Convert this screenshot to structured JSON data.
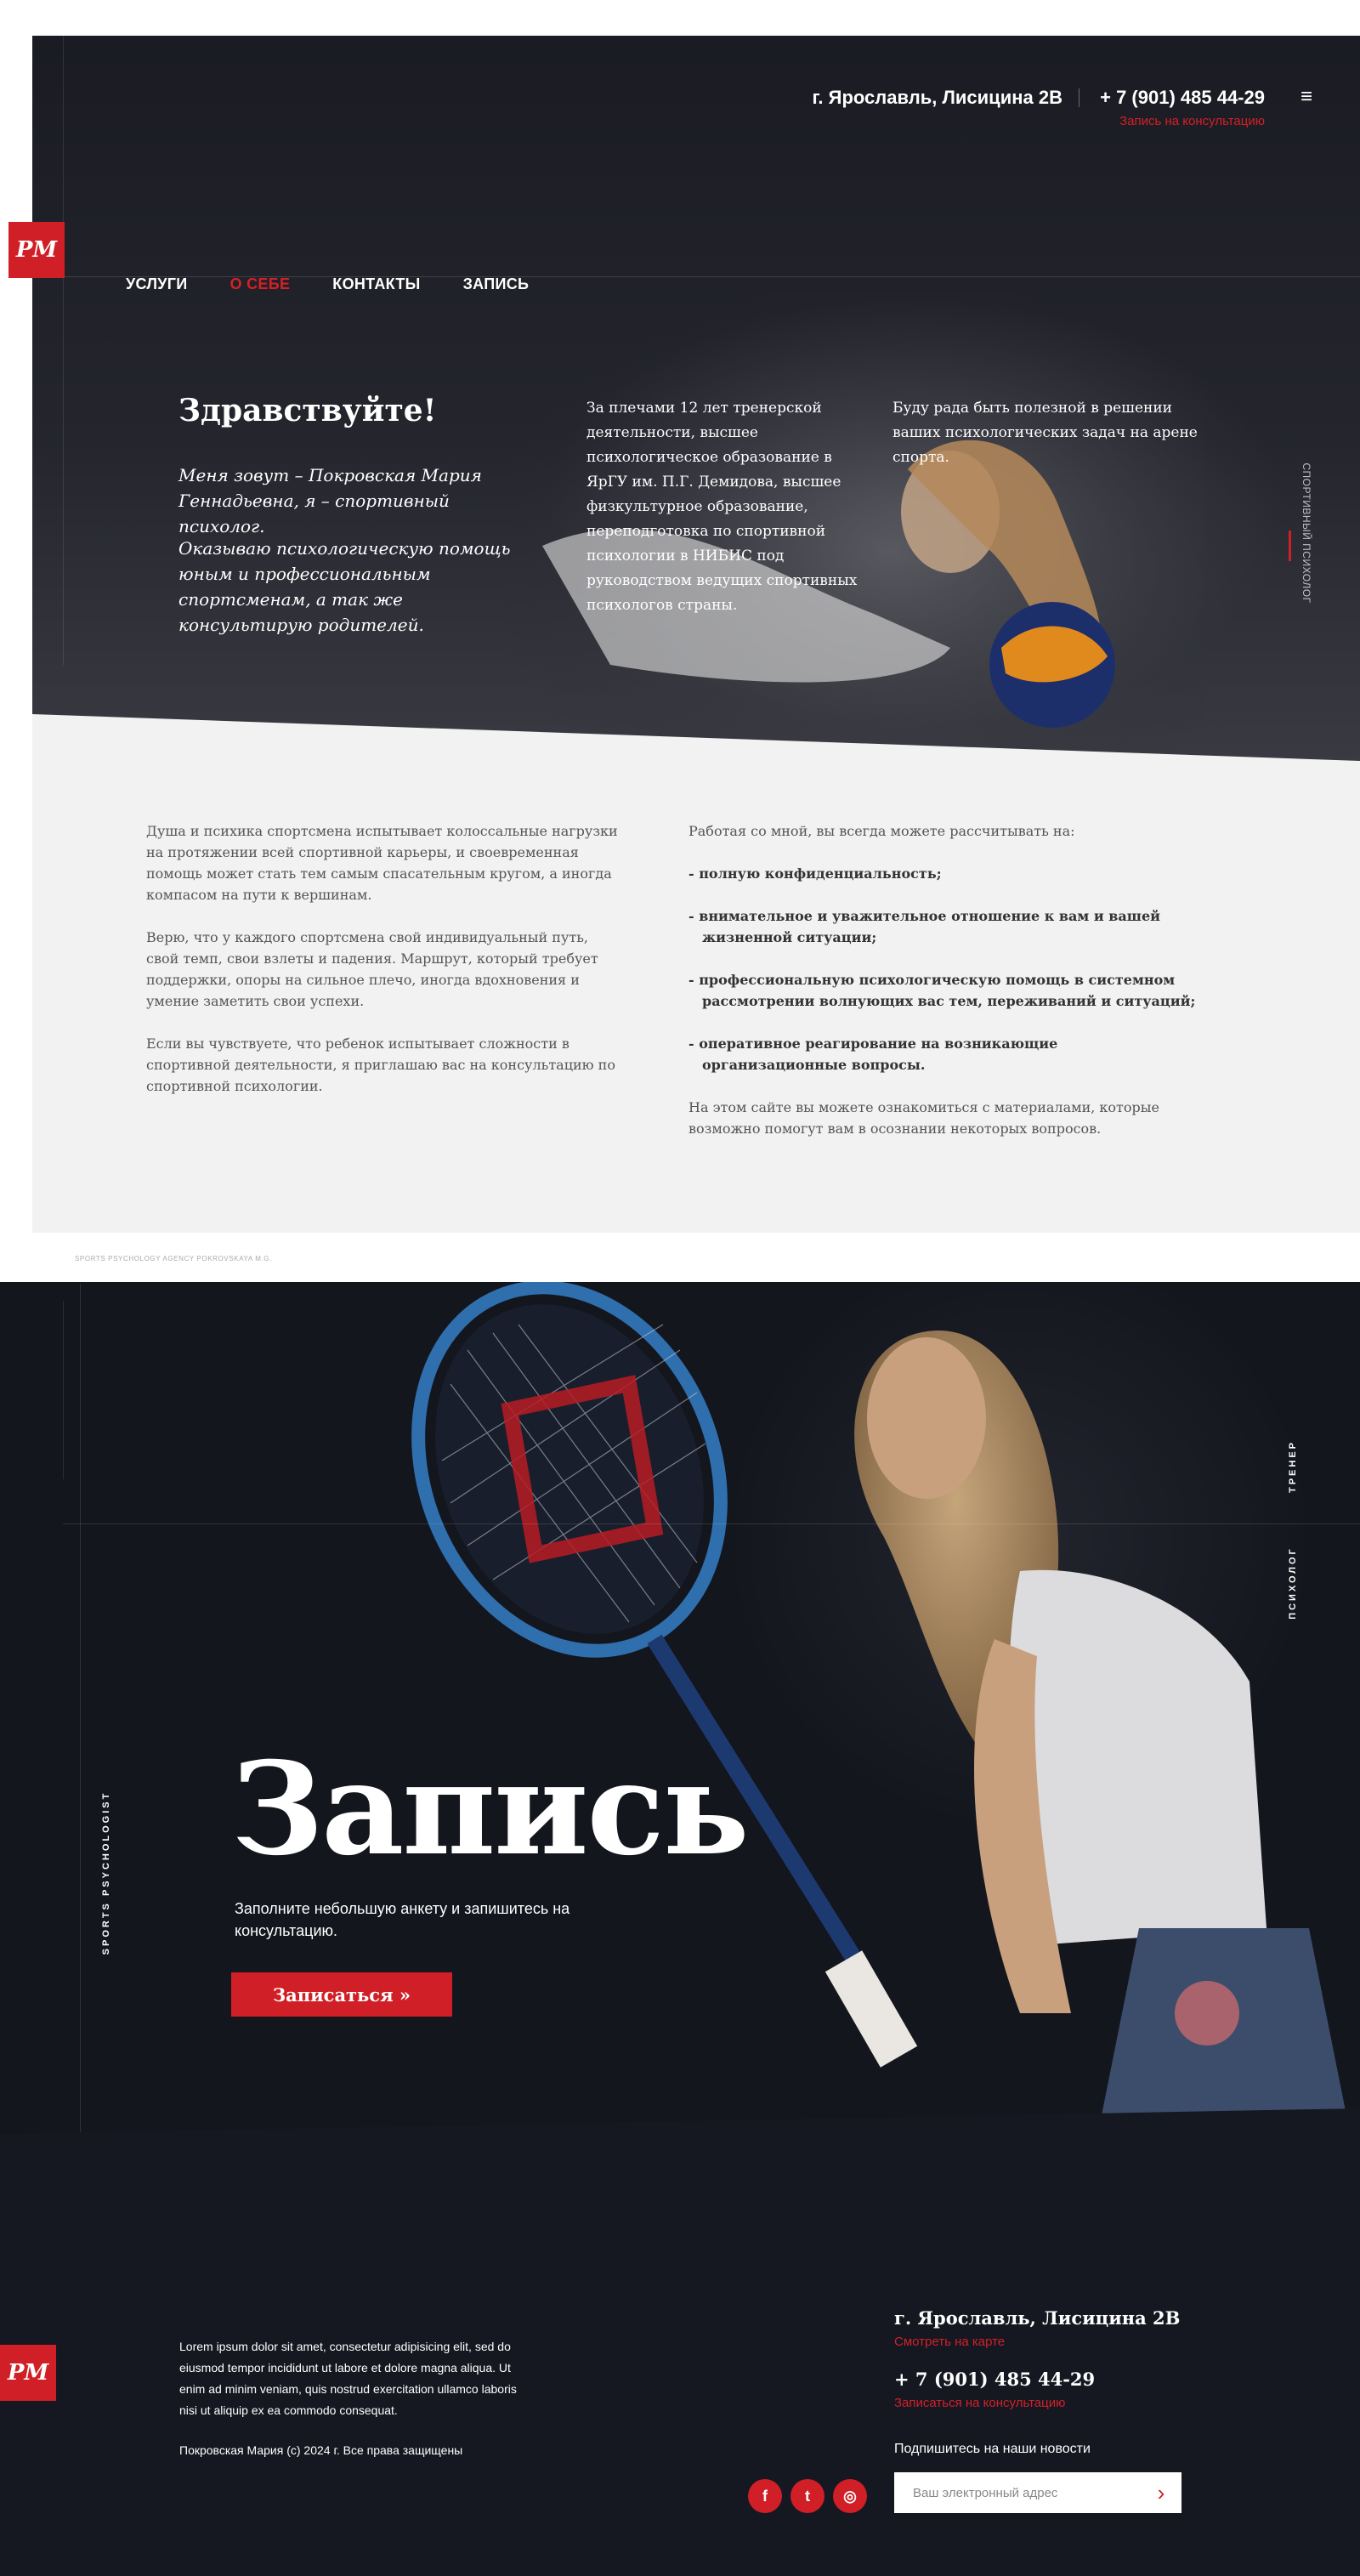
{
  "header": {
    "address": "г. Ярославль, Лисицина 2В",
    "phone": "+ 7 (901) 485 44-29",
    "consult_link": "Запись на консультацию",
    "menu_icon": "≡",
    "logo": "PM"
  },
  "nav": {
    "items": [
      {
        "label": "УСЛУГИ"
      },
      {
        "label": "О СЕБЕ"
      },
      {
        "label": "КОНТАКТЫ"
      },
      {
        "label": "ЗАПИСЬ"
      }
    ]
  },
  "hero": {
    "greeting": "Здравствуйте!",
    "intro": "Меня зовут – Покровская Мария Геннадьевна, я – спортивный психолог.",
    "help": "Оказываю психологическую помощь юным и профессиональным спортсменам, а так же консультирую родителей.",
    "column2": "За плечами 12 лет тренерской деятельности, высшее психологическое образование в ЯрГУ им. П.Г. Демидова, высшее физкультурное образование, переподготовка по спортивной психологии в НИБИС под руководством ведущих спортивных психологов страны.",
    "column3": "Буду рада быть полезной в решении ваших психологических задач на арене спорта.",
    "vertical_label": "СПОРТИВНЫЙ ПСИХОЛОГ"
  },
  "about": {
    "col1": [
      "Душа и психика спортсмена испытывает колоссальные нагрузки на протяжении всей спортивной карьеры, и своевременная помощь может стать тем самым спасательным кругом, а иногда компасом на пути к вершинам.",
      "Верю, что у каждого спортсмена свой индивидуальный путь, свой темп, свои взлеты и падения. Маршрут, который требует поддержки, опоры на сильное плечо, иногда вдохновения и умение заметить свои успехи.",
      "Если вы чувствуете, что ребенок испытывает сложности в спортивной деятельности, я приглашаю вас на консультацию по спортивной психологии."
    ],
    "col2_intro": "Работая со мной, вы всегда можете рассчитывать на:",
    "col2_items": [
      "- полную конфиденциальность;",
      "- внимательное и уважительное отношение к вам и вашей жизненной ситуации;",
      "- профессиональную психологическую помощь в системном рассмотрении волнующих вас тем, переживаний и ситуаций;",
      "- оперативное реагирование на возникающие организационные  вопросы."
    ],
    "col2_outro": "На этом сайте вы можете ознакомиться с материалами, которые возможно помогут вам в осознании некоторых вопросов."
  },
  "agency": "SPORTS PSYCHOLOGY AGENCY POKROVSKAYA M.G.",
  "booking": {
    "title": "Запись",
    "subtitle": "Заполните небольшую анкету и запишитесь на консультацию.",
    "button": "Записаться »",
    "vertical_sports": "SPORTS PSYCHOLOGIST",
    "vertical_coach": "ТРЕНЕР",
    "vertical_psy": "ПСИХОЛОГ"
  },
  "footer": {
    "logo": "PM",
    "lorem": "Lorem ipsum dolor sit amet, consectetur adipisicing elit, sed do eiusmod tempor incididunt ut labore et dolore magna aliqua. Ut enim ad minim veniam, quis nostrud exercitation ullamco laboris nisi ut aliquip ex ea commodo consequat.",
    "copyright": "Покровская Мария (c)  2024 г. Все права защищены",
    "address": "г. Ярославль, Лисицина 2В",
    "map_link": "Смотреть на карте",
    "phone": "+ 7 (901) 485 44-29",
    "consult_link": "Записаться на консультацию",
    "newsletter_label": "Подпишитесь на наши новости",
    "email_placeholder": "Ваш электронный адрес",
    "submit_icon": "›",
    "social": [
      {
        "icon": "facebook-icon",
        "glyph": "f"
      },
      {
        "icon": "twitter-icon",
        "glyph": "t"
      },
      {
        "icon": "instagram-icon",
        "glyph": "◎"
      }
    ]
  },
  "colors": {
    "accent": "#d01f26",
    "dark_bg": "#151821",
    "light_bg": "#f2f2f2"
  }
}
